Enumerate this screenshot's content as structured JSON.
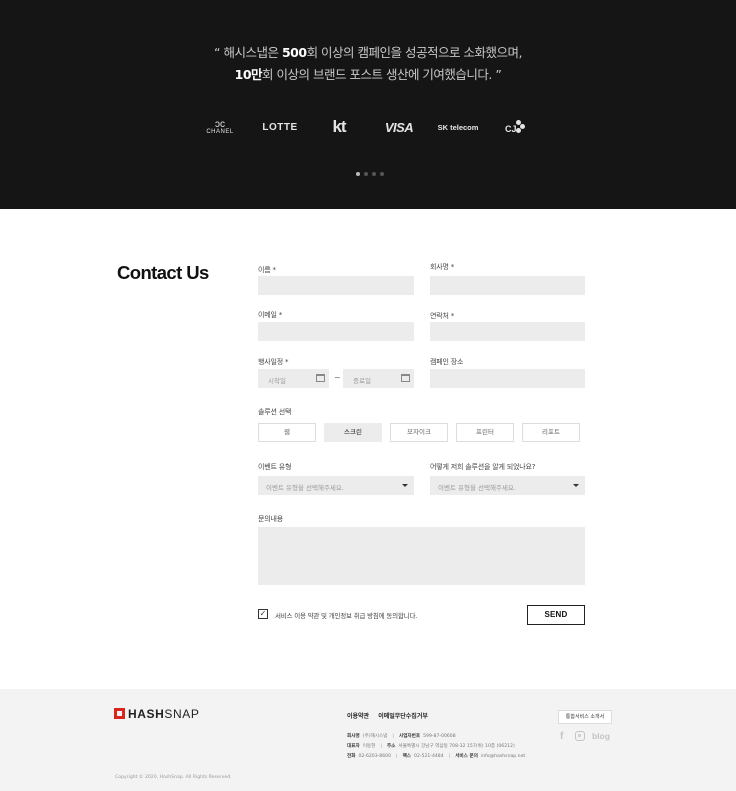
{
  "hero": {
    "quote_line1_pre": "“ 해시스냅은 ",
    "quote_line1_bold": "500",
    "quote_line1_post": "회 이상의 캠페인을 성공적으로 소화했으며,",
    "quote_line2_bold": "10만",
    "quote_line2_post": "회 이상의 브랜드 포스트 생산에 기여했습니다. ”",
    "brands": [
      "CHANEL",
      "LOTTE",
      "kt",
      "VISA",
      "SK telecom",
      "CJ"
    ],
    "carousel_dots": 4,
    "active_dot": 0
  },
  "contact": {
    "title": "Contact Us",
    "name_label": "이름",
    "company_label": "회사명",
    "email_label": "이메일",
    "phone_label": "연락처",
    "required_mark": "*",
    "schedule_label": "행사일정",
    "start_placeholder": "시작일",
    "end_placeholder": "종료일",
    "range_sep": "~",
    "place_label": "캠페인 장소",
    "solution_label": "솔루션 선택",
    "solutions": [
      "웹",
      "스크린",
      "모자이크",
      "프린터",
      "리포트"
    ],
    "selected_solution": "스크린",
    "event_type_label": "이벤트 유형",
    "event_type_placeholder": "이벤트 유형을 선택해주세요.",
    "referral_label": "어떻게 저희 솔루션을 알게 되었나요?",
    "referral_placeholder": "이벤트 유형을 선택해주세요.",
    "inquiry_label": "문의내용",
    "agree_text": "서비스 이용 약관 및 개인정보 취급 방침에 동의합니다.",
    "agree_checked": true,
    "send_label": "SEND"
  },
  "footer": {
    "logo_bold": "HASH",
    "logo_rest": "SNAP",
    "logo_color": "#d7261e",
    "links": [
      "이용약관",
      "이메일무단수집거부"
    ],
    "company_label": "회사명",
    "company_value": "(주)해시스냅",
    "bizno_label": "사업자번호",
    "bizno_value": "599-87-00608",
    "ceo_label": "대표자",
    "ceo_value": "이동현",
    "address_label": "주소",
    "address_value": "서울특별시 강남구 역삼동 708-32 157(위) 10층 (06212)",
    "tel_label": "전화",
    "tel_value": "02-6203-8600",
    "fax_label": "팩스",
    "fax_value": "02-521-4484",
    "service_label": "서비스 문의",
    "service_value": "info@hashsnap.net",
    "copyright": "Copyright © 2020, HashSnap. All Rights Reserved.",
    "integrated_button": "통합서비스 소개서",
    "blog_label": "blog"
  }
}
